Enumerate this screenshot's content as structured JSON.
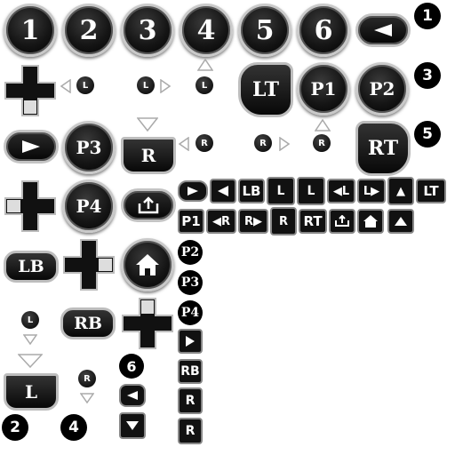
{
  "face_buttons": [
    "1",
    "2",
    "3",
    "4",
    "5",
    "6"
  ],
  "shoulder_labels": {
    "lt": "LT",
    "rt": "RT",
    "lb": "LB",
    "rb": "RB",
    "p1": "P1",
    "p2": "P2",
    "p3": "P3",
    "p4": "P4",
    "l": "L",
    "r": "R"
  },
  "stick_labels": {
    "left": "L",
    "right": "R"
  },
  "numbers_right": [
    "1",
    "3",
    "5"
  ],
  "numbers_bottom": [
    "2",
    "4"
  ],
  "num_six": "6",
  "small_row1": [
    "LB",
    "L",
    "L",
    "LT"
  ],
  "small_row2": [
    "P1",
    "R",
    "R",
    "R",
    "RT"
  ],
  "small_col": [
    "P2",
    "P3",
    "P4",
    "RB",
    "R",
    "R"
  ]
}
